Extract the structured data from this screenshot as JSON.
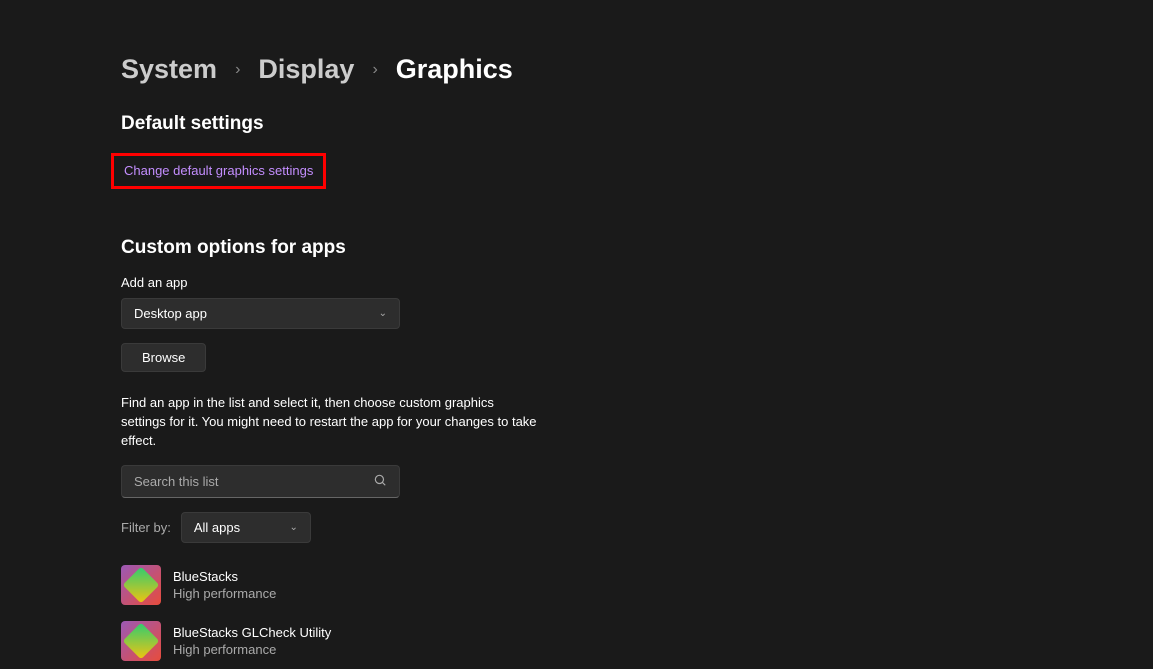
{
  "breadcrumb": {
    "system": "System",
    "display": "Display",
    "graphics": "Graphics"
  },
  "sections": {
    "default_settings_title": "Default settings",
    "change_link": "Change default graphics settings",
    "custom_options_title": "Custom options for apps",
    "add_app_label": "Add an app",
    "dropdown_value": "Desktop app",
    "browse_button": "Browse",
    "help_text": "Find an app in the list and select it, then choose custom graphics settings for it. You might need to restart the app for your changes to take effect.",
    "search_placeholder": "Search this list",
    "filter_label": "Filter by:",
    "filter_value": "All apps"
  },
  "apps": [
    {
      "name": "BlueStacks",
      "status": "High performance"
    },
    {
      "name": "BlueStacks GLCheck Utility",
      "status": "High performance"
    }
  ]
}
